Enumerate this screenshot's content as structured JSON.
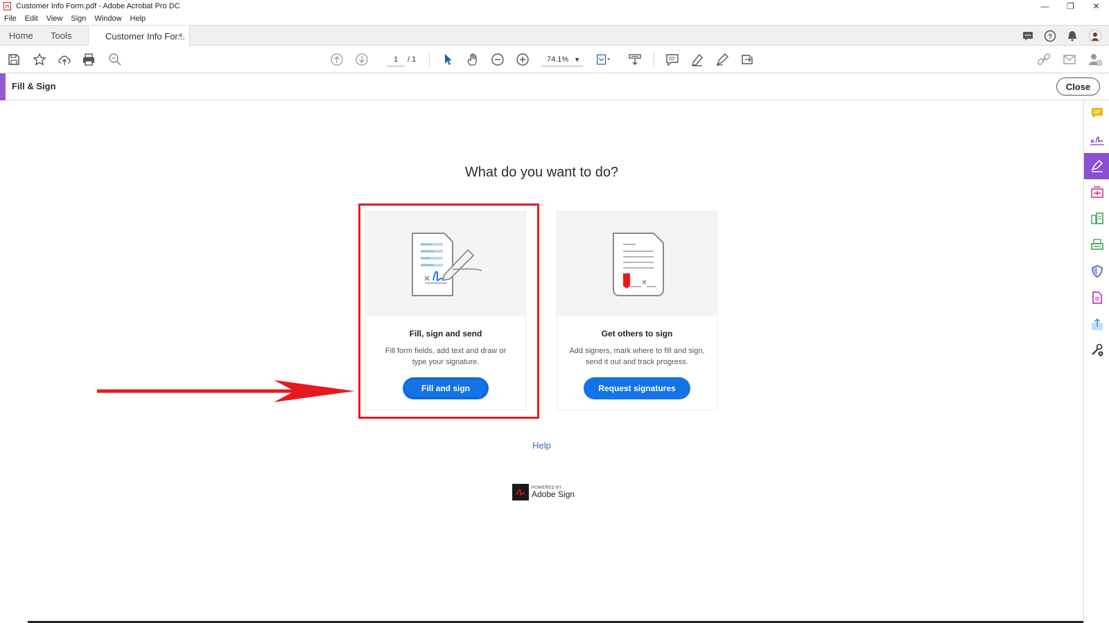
{
  "window": {
    "title": "Customer Info Form.pdf - Adobe Acrobat Pro DC",
    "controls": [
      "minimize-icon",
      "restore-icon",
      "close-icon"
    ]
  },
  "menu": [
    "File",
    "Edit",
    "View",
    "Sign",
    "Window",
    "Help"
  ],
  "tabs": {
    "home": "Home",
    "tools": "Tools",
    "document": "Customer Info For...",
    "close_glyph": "×"
  },
  "toolbar": {
    "page_current": "1",
    "page_total": "/ 1",
    "zoom": "74.1%"
  },
  "tool_panel": {
    "title": "Fill & Sign",
    "close_label": "Close",
    "accent_color": "#9b59d0"
  },
  "main": {
    "heading": "What do you want to do?",
    "cards": [
      {
        "title": "Fill, sign and send",
        "description": "Fill form fields, add text and draw or type your signature.",
        "button": "Fill and sign"
      },
      {
        "title": "Get others to sign",
        "description": "Add signers, mark where to fill and sign, send it out and track progress.",
        "button": "Request signatures"
      }
    ],
    "help_link": "Help",
    "powered_by": "POWERED BY",
    "brand": "Adobe Sign"
  },
  "colors": {
    "primary_button": "#1473e6",
    "highlight_annotation": "#e8191e",
    "link": "#2d6db5"
  }
}
